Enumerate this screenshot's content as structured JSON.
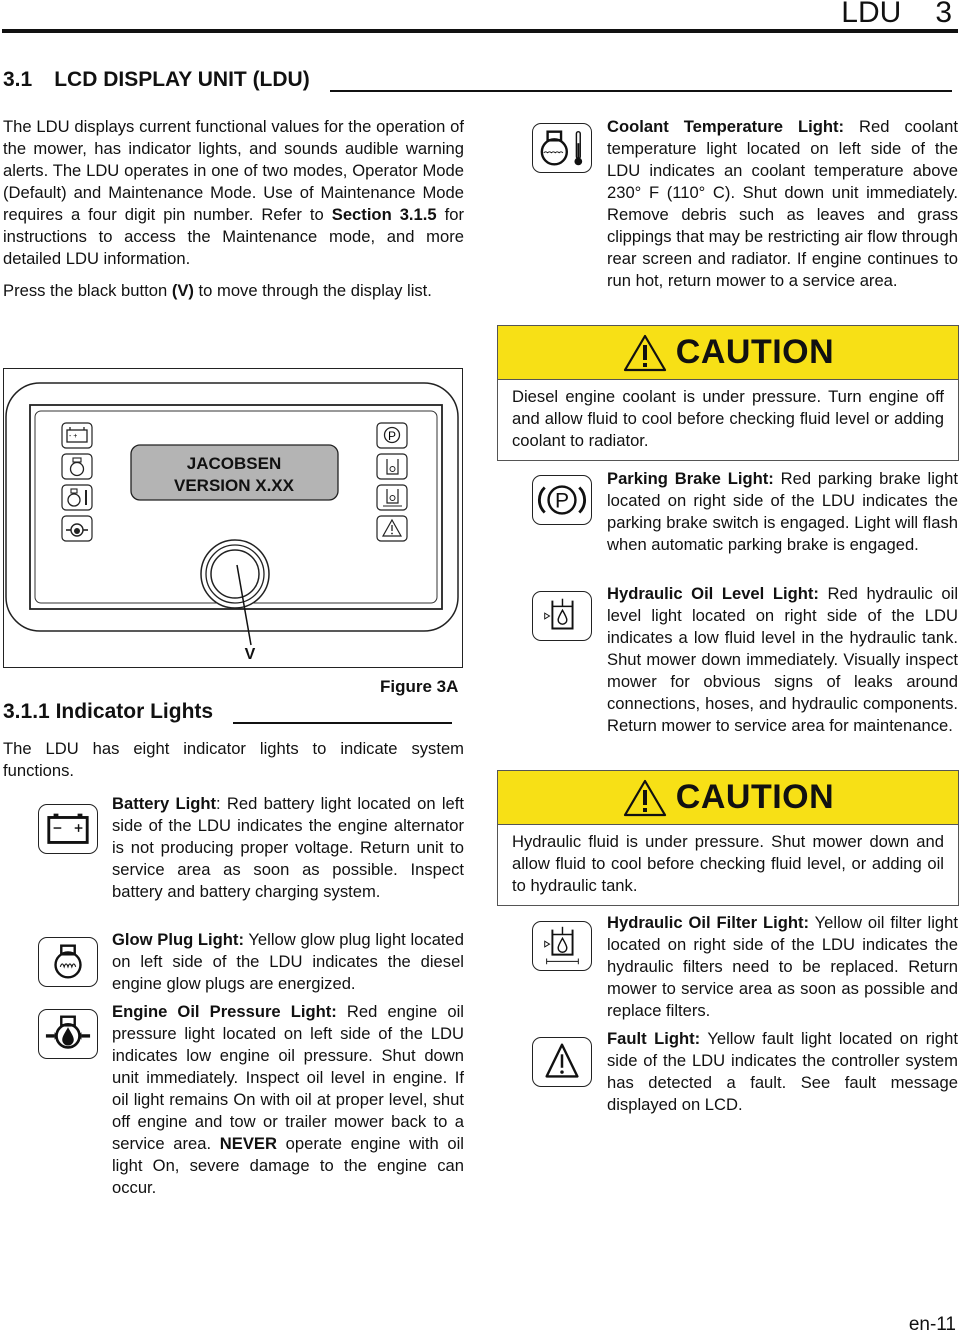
{
  "header": {
    "title": "LDU",
    "chapter": "3"
  },
  "section": {
    "number": "3.1",
    "title": "LCD DISPLAY UNIT (LDU)"
  },
  "intro": {
    "p1_a": "The LDU displays current functional values for the operation of the mower, has indicator lights, and sounds audible warning alerts. The LDU operates in one of two modes, Operator Mode (Default) and Maintenance Mode. Use of Maintenance Mode requires a four digit pin number. Refer to ",
    "p1_ref": "Section 3.1.5",
    "p1_b": " for instructions to access the Maintenance mode, and more detailed LDU information.",
    "p2_a": "Press the black button ",
    "p2_ref": "(V)",
    "p2_b": " to move through the display list."
  },
  "figure": {
    "lcd_line1": "JACOBSEN",
    "lcd_line2": "VERSION X.XX",
    "button_label": "V",
    "caption": "Figure 3A",
    "left_icons": [
      "battery-icon",
      "glow-plug-icon",
      "coolant-temperature-icon",
      "oil-pressure-icon"
    ],
    "right_icons": [
      "parking-brake-icon",
      "hydraulic-oil-level-icon",
      "hydraulic-oil-filter-icon",
      "fault-icon"
    ]
  },
  "subsection": {
    "number": "3.1.1",
    "title": "Indicator Lights",
    "intro": "The LDU has eight indicator lights to indicate system functions."
  },
  "lights": [
    {
      "icon": "battery-icon",
      "title": "Battery Light",
      "sep": ":",
      "text": " Red battery light located on left side of the LDU indicates the engine alternator is not producing proper voltage. Return unit to service area as soon as possible. Inspect battery and battery charging system."
    },
    {
      "icon": "glow-plug-icon",
      "title": "Glow Plug Light:",
      "text": " Yellow glow plug light located on left side of the LDU indicates the diesel engine glow plugs are energized."
    },
    {
      "icon": "oil-pressure-icon",
      "title": "Engine Oil Pressure Light:",
      "text": " Red engine oil pressure light located on left side of the LDU indicates low engine oil pressure. Shut down unit immediately. Inspect oil level in engine. If oil light remains On with oil at proper level, shut off engine and tow or trailer mower back to a service area. ",
      "emph": "NEVER",
      "text2": " operate engine with oil light On, severe damage to the engine can occur."
    },
    {
      "icon": "coolant-temperature-icon",
      "title": "Coolant Temperature Light:",
      "text": " Red coolant temperature light located on left side of the LDU indicates an coolant temperature above 230° F (110° C). Shut down unit immediately. Remove debris such as leaves and grass clippings that may be restricting air flow through rear screen and radiator. If engine continues to run hot, return mower to a service area."
    },
    {
      "icon": "parking-brake-icon",
      "title": "Parking Brake Light:",
      "text": " Red parking brake light located on right side of the LDU indicates the parking brake switch is engaged. Light will flash when automatic parking brake is engaged."
    },
    {
      "icon": "hydraulic-oil-level-icon",
      "title": "Hydraulic Oil Level Light:",
      "text": " Red hydraulic oil level light located on right side of the LDU indicates a low fluid level in the hydraulic tank. Shut mower down immediately. Visually inspect mower for obvious signs of leaks around connections, hoses, and hydraulic components. Return mower to service area for maintenance."
    },
    {
      "icon": "hydraulic-oil-filter-icon",
      "title": "Hydraulic Oil Filter Light:",
      "text": " Yellow oil filter light located on right side of the LDU indicates the hydraulic filters need to be replaced. Return mower to service area as soon as possible and replace filters."
    },
    {
      "icon": "fault-icon",
      "title": "Fault Light:",
      "text": " Yellow fault light located on right side of the LDU indicates the controller system has detected a fault. See fault message displayed on LCD."
    }
  ],
  "cautions": [
    {
      "label": "CAUTION",
      "text": "Diesel engine coolant is under pressure. Turn engine off and allow fluid to cool before checking fluid level or adding coolant to radiator."
    },
    {
      "label": "CAUTION",
      "text": "Hydraulic fluid is under pressure. Shut mower down and allow fluid to cool before checking fluid level, or adding oil to hydraulic tank."
    }
  ],
  "colors": {
    "caution_yellow": "#f7e016",
    "lcd_gray": "#b4b4b4",
    "text": "#111111"
  },
  "footer": {
    "page": "en-11"
  }
}
